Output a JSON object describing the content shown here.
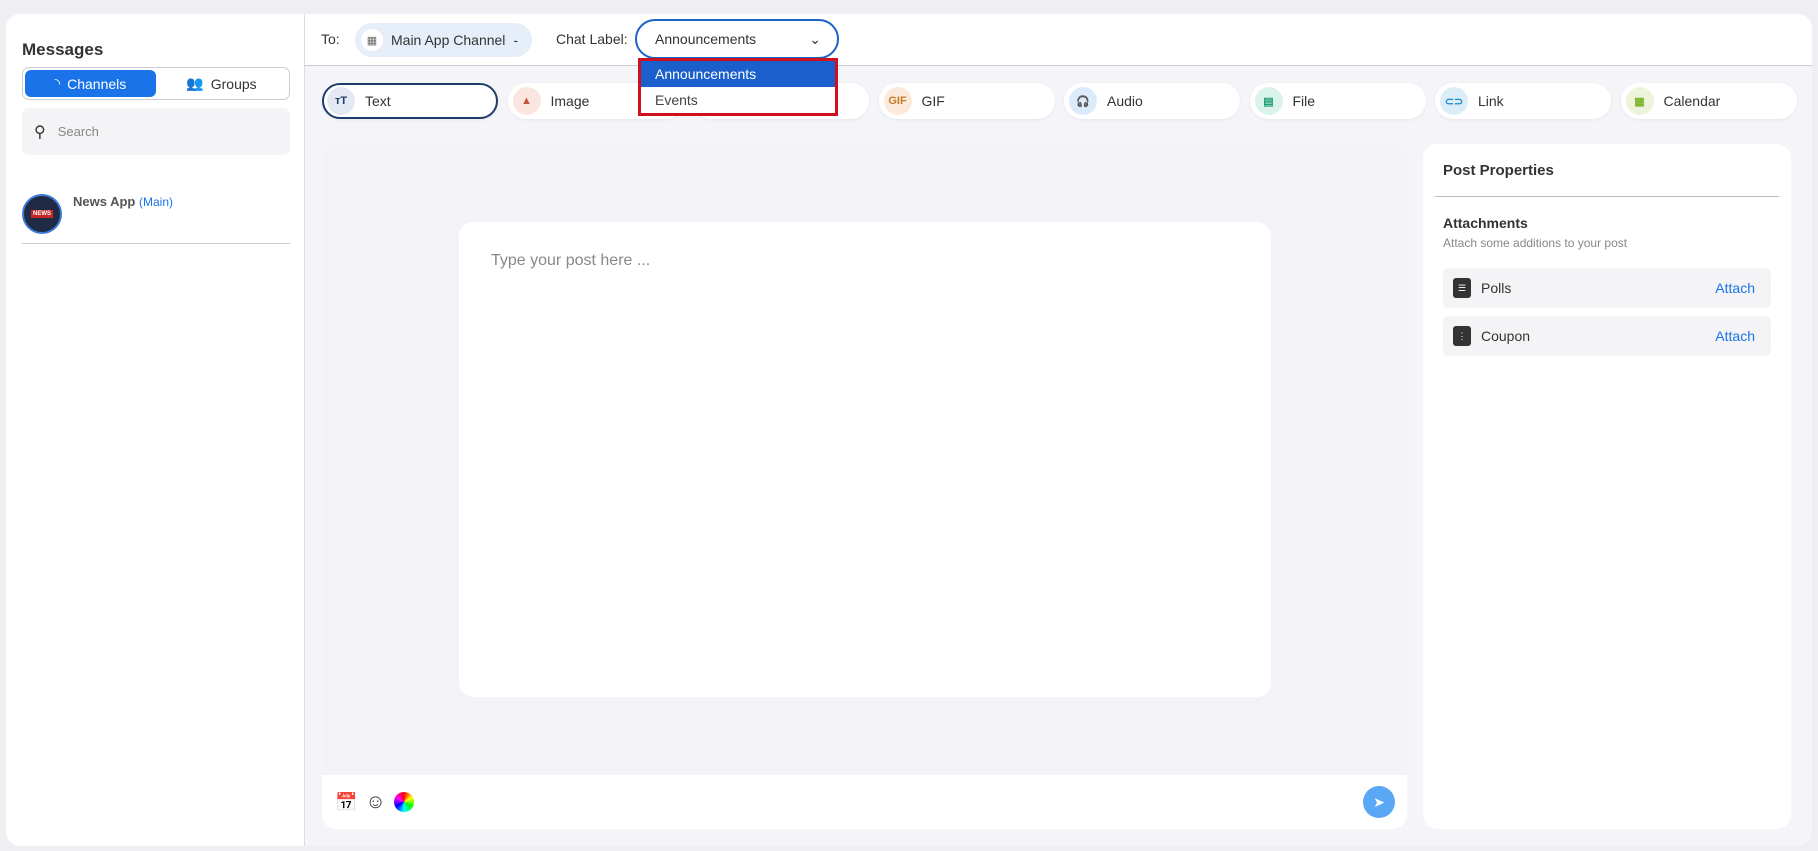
{
  "sidebar": {
    "title": "Messages",
    "channels_label": "Channels",
    "groups_label": "Groups",
    "search_placeholder": "Search",
    "channel": {
      "name": "News App",
      "tag": "(Main)",
      "avatar_text": "NEWS"
    }
  },
  "header": {
    "to_label": "To:",
    "recipient": "Main App Channel",
    "recipient_remove": "-",
    "chat_label": "Chat Label:",
    "selected": "Announcements",
    "options": [
      "Announcements",
      "Events"
    ]
  },
  "tabs": [
    {
      "label": "Text",
      "icon": "text-icon",
      "color": "#1f3d6b",
      "bg": "#e3e8f2",
      "glyph": "ᴛT"
    },
    {
      "label": "Image",
      "icon": "image-icon",
      "color": "#c0553a",
      "bg": "#fbe6df",
      "glyph": "▲"
    },
    {
      "label": "",
      "icon": "hidden-icon",
      "color": "#888",
      "bg": "#eee",
      "glyph": ""
    },
    {
      "label": "GIF",
      "icon": "gif-icon",
      "color": "#c77a2a",
      "bg": "#fbeadb",
      "glyph": "GIF"
    },
    {
      "label": "Audio",
      "icon": "headphones-icon",
      "color": "#1a73e8",
      "bg": "#dcebfb",
      "glyph": "🎧"
    },
    {
      "label": "File",
      "icon": "file-icon",
      "color": "#1b9e6e",
      "bg": "#daf3ea",
      "glyph": "▤"
    },
    {
      "label": "Link",
      "icon": "link-icon",
      "color": "#1e88c7",
      "bg": "#dbeef8",
      "glyph": "⊂⊃"
    },
    {
      "label": "Calendar",
      "icon": "calendar-icon",
      "color": "#7cb32b",
      "bg": "#ecf5dc",
      "glyph": "▦"
    }
  ],
  "editor": {
    "placeholder": "Type your post here ..."
  },
  "props": {
    "title": "Post Properties",
    "att_title": "Attachments",
    "att_sub": "Attach some additions to your post",
    "items": [
      {
        "label": "Polls",
        "action": "Attach"
      },
      {
        "label": "Coupon",
        "action": "Attach"
      }
    ]
  }
}
